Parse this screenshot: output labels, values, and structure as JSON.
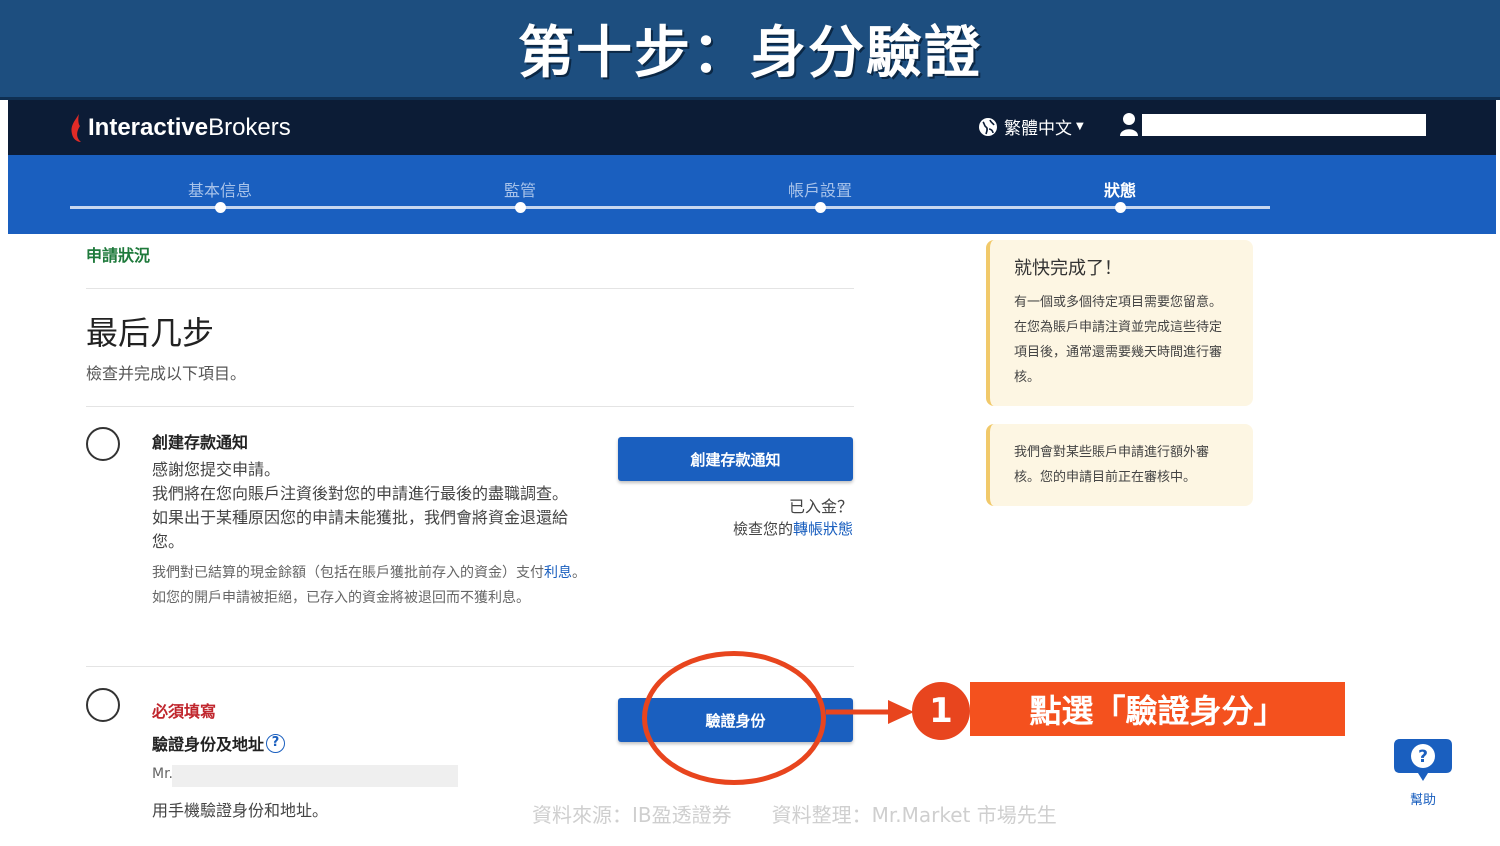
{
  "banner": {
    "title": "第十步：身分驗證"
  },
  "header": {
    "logo_bold": "Interactive",
    "logo_regular": "Brokers",
    "language": "繁體中文",
    "language_icon": "globe-icon",
    "user_icon": "user-icon"
  },
  "steps": [
    {
      "label": "基本信息",
      "active": false
    },
    {
      "label": "監管",
      "active": false
    },
    {
      "label": "帳戶設置",
      "active": false
    },
    {
      "label": "狀態",
      "active": true
    }
  ],
  "main": {
    "section_label": "申請狀況",
    "title": "最后几步",
    "subtitle": "檢查并完成以下項目。",
    "deposit": {
      "title": "創建存款通知",
      "line1": "感謝您提交申請。",
      "body": "我們將在您向賬戶注資後對您的申請進行最後的盡職調查。如果出于某種原因您的申請未能獲批，我們會將資金退還給您。",
      "note_part1": "我們對已結算的現金餘額（包括在賬戶獲批前存入的資金）支付",
      "note_link": "利息",
      "note_part2": "。如您的開戶申請被拒絕，已存入的資金將被退回而不獲利息。",
      "button": "創建存款通知",
      "funded_q": "已入金？",
      "check_prefix": "檢查您的",
      "check_link": "轉帳狀態"
    },
    "verify": {
      "required": "必須填寫",
      "title": "驗證身份及地址",
      "help_glyph": "?",
      "name_prefix": "Mr.",
      "desc": "用手機驗證身份和地址。",
      "button": "驗證身份"
    }
  },
  "sidebar": {
    "card1": {
      "title": "就快完成了！",
      "text": "有一個或多個待定項目需要您留意。在您為賬戶申請注資並完成這些待定項目後，通常還需要幾天時間進行審核。"
    },
    "card2": {
      "text": "我們會對某些賬戶申請進行額外審核。您的申請目前正在審核中。"
    }
  },
  "annotation": {
    "number": "1",
    "instruction": "點選「驗證身分」",
    "color": "#f4511e"
  },
  "help": {
    "label": "幫助",
    "glyph": "?"
  },
  "footer": {
    "credit": "資料來源：IB盈透證券　　資料整理：Mr.Market 市場先生"
  },
  "colors": {
    "banner": "#1d4e7f",
    "header": "#0c1c36",
    "accent": "#1a5fbf",
    "required": "#c0262d",
    "section_green": "#1f7a3c"
  }
}
